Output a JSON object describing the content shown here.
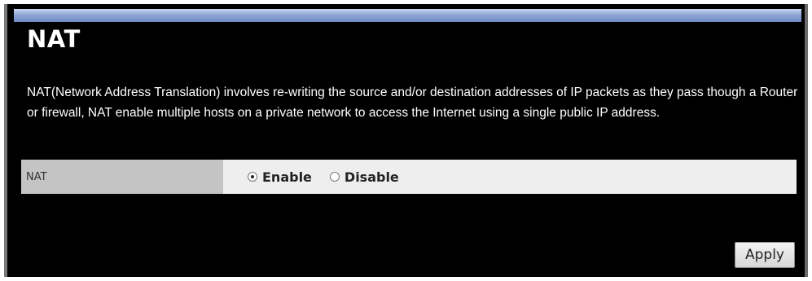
{
  "page": {
    "title": "NAT",
    "description": "NAT(Network Address Translation) involves re-writing the source and/or destination addresses of IP packets as they pass though a Router or firewall, NAT enable multiple hosts on a private network to access the Internet using a single public IP address."
  },
  "nat_setting": {
    "label": "NAT",
    "options": [
      {
        "label": "Enable",
        "selected": true
      },
      {
        "label": "Disable",
        "selected": false
      }
    ]
  },
  "actions": {
    "apply_label": "Apply"
  },
  "colors": {
    "background": "#000000",
    "header_bar": "#8fa6d6",
    "label_cell": "#c4c4c4",
    "value_cell": "#eeeeee"
  }
}
